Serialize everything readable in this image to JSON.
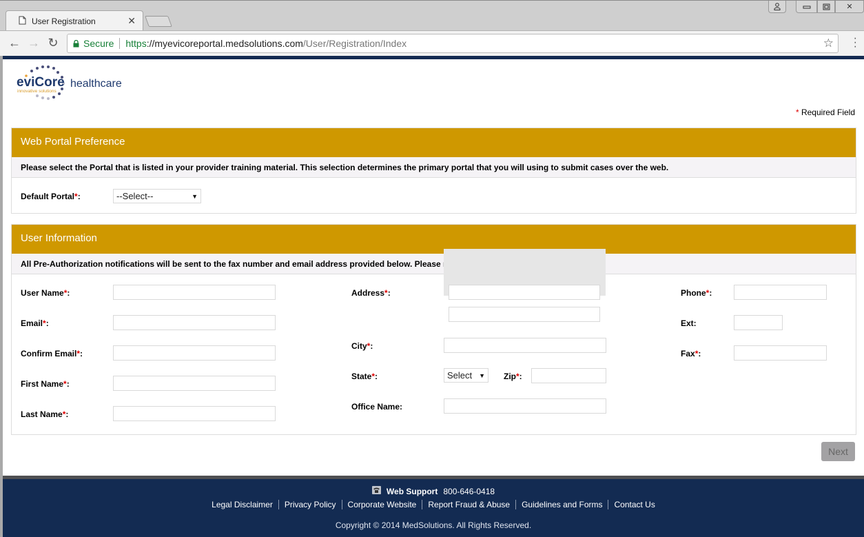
{
  "browser": {
    "tab_title": "User Registration",
    "tab_icon": "page-icon",
    "secure_label": "Secure",
    "url_scheme": "https",
    "url_host": "://myevicoreportal.medsolutions.com",
    "url_path": "/User/Registration/Index"
  },
  "header": {
    "logo_brand": "eviCore",
    "logo_tagline": "innovative solutions",
    "logo_suffix": "healthcare",
    "required_star": "*",
    "required_label": " Required Field"
  },
  "portal_panel": {
    "title": "Web Portal Preference",
    "note": "Please select the Portal that is listed in your provider training material. This selection determines the primary portal that you will using to submit cases over the web.",
    "default_portal_label": "Default Portal",
    "default_portal_value": "--Select--"
  },
  "user_panel": {
    "title": "User Information",
    "note": "All Pre-Authorization notifications will be sent to the fax number and email address provided below. Please make sure you provide valid information.",
    "fields": {
      "user_name": {
        "label": "User Name",
        "value": ""
      },
      "email": {
        "label": "Email",
        "value": ""
      },
      "confirm_email": {
        "label": "Confirm Email",
        "value": ""
      },
      "first_name": {
        "label": "First Name",
        "value": ""
      },
      "last_name": {
        "label": "Last Name",
        "value": ""
      },
      "address": {
        "label": "Address",
        "line1": "",
        "line2": ""
      },
      "city": {
        "label": "City",
        "value": ""
      },
      "state": {
        "label": "State",
        "value": "Select"
      },
      "zip": {
        "label": "Zip",
        "value": ""
      },
      "office_name": {
        "label": "Office Name:",
        "value": ""
      },
      "phone": {
        "label": "Phone",
        "value": ""
      },
      "ext": {
        "label": "Ext:",
        "value": ""
      },
      "fax": {
        "label": "Fax",
        "value": ""
      }
    },
    "star": "*",
    "colon": ":"
  },
  "actions": {
    "next_label": "Next"
  },
  "footer": {
    "support_label": "Web Support",
    "support_phone": "800-646-0418",
    "links": [
      "Legal Disclaimer",
      "Privacy Policy",
      "Corporate Website",
      "Report Fraud & Abuse",
      "Guidelines and Forms",
      "Contact Us"
    ],
    "copyright": "Copyright © 2014 MedSolutions. All Rights Reserved."
  },
  "colors": {
    "panel_header": "#cf9800",
    "footer_bg": "#132b52",
    "required": "#dd0000",
    "secure": "#188038"
  }
}
